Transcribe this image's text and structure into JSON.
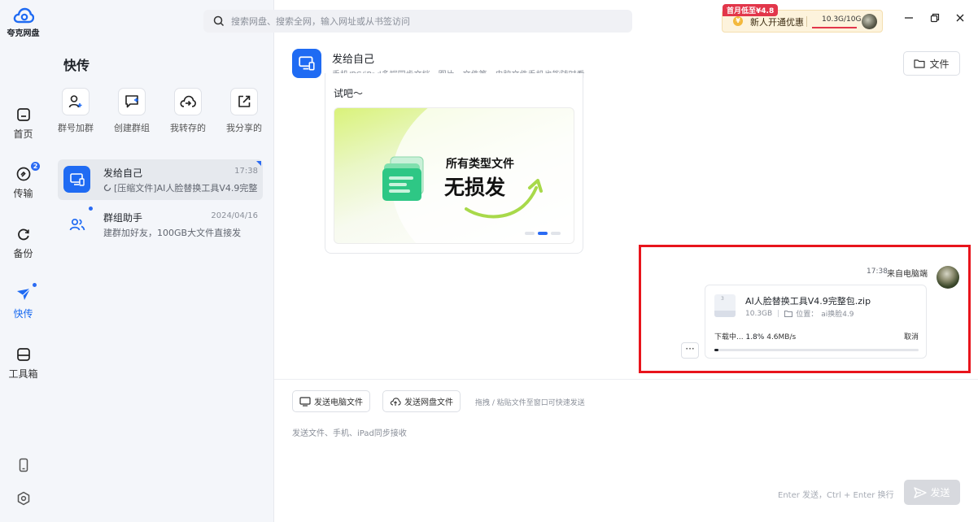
{
  "app": {
    "logo_text": "夸克网盘"
  },
  "rail": {
    "items": [
      {
        "label": "首页"
      },
      {
        "label": "传输",
        "badge": "2"
      },
      {
        "label": "备份"
      },
      {
        "label": "快传"
      },
      {
        "label": "工具箱"
      }
    ]
  },
  "panel": {
    "title": "快传",
    "actions": [
      {
        "label": "群号加群",
        "icon": "add-user-icon"
      },
      {
        "label": "创建群组",
        "icon": "create-group-icon"
      },
      {
        "label": "我转存的",
        "icon": "cloud-save-icon"
      },
      {
        "label": "我分享的",
        "icon": "share-icon"
      }
    ],
    "conversations": [
      {
        "name": "发给自己",
        "time": "17:38",
        "sub": "[压缩文件]AI人脸替换工具V4.9完整..."
      },
      {
        "name": "群组助手",
        "time": "2024/04/16",
        "sub": "建群加好友，100GB大文件直接发"
      }
    ]
  },
  "search": {
    "placeholder": "搜索网盘、搜索全网，输入网址或从书签访问"
  },
  "promo": {
    "tag": "首月低至¥4.8",
    "text": "新人开通优惠",
    "storage": "10.3G/10G",
    "storage_fraction": 1.0
  },
  "header": {
    "title": "发给自己",
    "subtitle": "手机/PC/iPad多端同步文档、图片、文件等，电脑文件手机也能随时看",
    "file_button": "文件"
  },
  "messages": {
    "received_text": "试吧～",
    "banner_line1": "所有类型文件",
    "banner_line2": "无损发",
    "sent_time": "17:38",
    "sent_from": "来自电脑端",
    "file": {
      "name": "AI人脸替换工具V4.9完整包.zip",
      "size": "10.3GB",
      "location_label": "位置：",
      "location": "ai换脸4.9",
      "status": "下载中...",
      "percent": "1.8%",
      "speed": "4.6MB/s",
      "cancel": "取消",
      "progress": 0.018
    },
    "more": "···"
  },
  "composer": {
    "send_pc_file": "发送电脑文件",
    "send_cloud_file": "发送网盘文件",
    "drop_hint": "拖拽 / 粘贴文件至窗口可快速发送",
    "placeholder": "发送文件、手机、iPad同步接收",
    "send_hint": "Enter 发送，Ctrl + Enter 换行",
    "send": "发送"
  },
  "colors": {
    "accent": "#1f6bf3",
    "highlight": "#e8141c",
    "promo_red": "#e2364a"
  }
}
